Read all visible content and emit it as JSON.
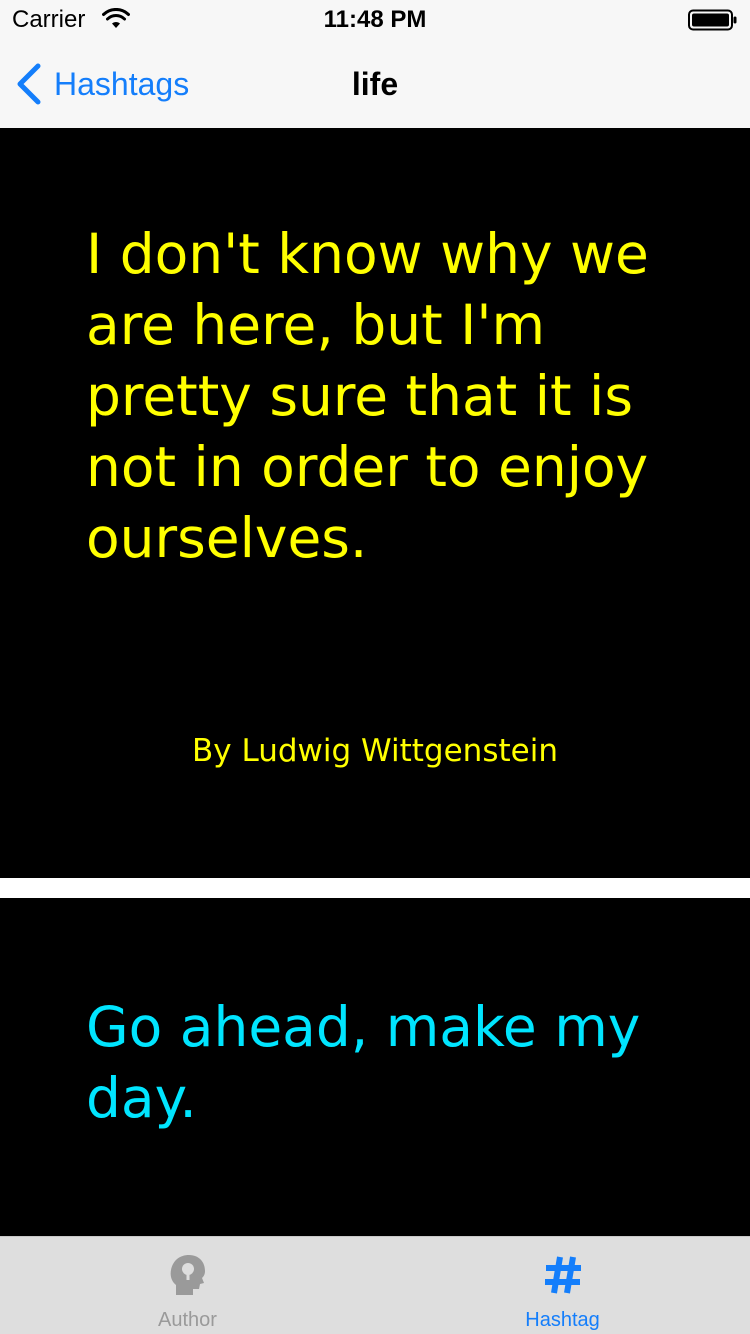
{
  "status_bar": {
    "carrier": "Carrier",
    "time": "11:48 PM",
    "wifi_icon": "wifi-icon",
    "battery_icon": "battery-icon"
  },
  "nav": {
    "back_label": "Hashtags",
    "back_icon": "chevron-left-icon",
    "title": "life",
    "accent_color": "#147efb"
  },
  "quotes": [
    {
      "text": "I don't know why we are here, but I'm pretty sure that it is not in order to enjoy ourselves.",
      "author": "By  Ludwig Wittgenstein",
      "text_color": "#ffff00",
      "background": "#000000"
    },
    {
      "text": "Go ahead, make my day.",
      "text_color": "#00e5ff",
      "background": "#000000"
    }
  ],
  "tab_bar": {
    "tabs": [
      {
        "label": "Author",
        "icon": "head-profile-icon",
        "selected": false,
        "color": "#9a9a9a"
      },
      {
        "label": "Hashtag",
        "icon": "hashtag-icon",
        "selected": true,
        "color": "#147efb"
      }
    ]
  }
}
